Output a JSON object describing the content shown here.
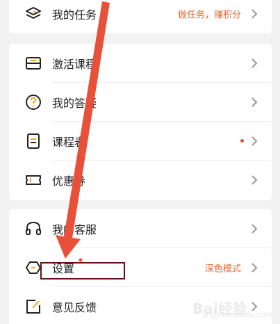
{
  "menu": {
    "group1": [
      {
        "id": "tasks",
        "label": "我的任务",
        "hint": "做任务，赚积分",
        "icon": "stack-layers-icon"
      }
    ],
    "group2": [
      {
        "id": "activate-course",
        "label": "激活课程",
        "icon": "ticket-icon"
      },
      {
        "id": "my-qa",
        "label": "我的答疑",
        "icon": "question-circle-icon"
      },
      {
        "id": "schedule",
        "label": "课程表",
        "icon": "schedule-list-icon",
        "badge": "red-dot"
      },
      {
        "id": "coupon",
        "label": "优惠券",
        "icon": "coupon-icon"
      }
    ],
    "group3": [
      {
        "id": "customer-service",
        "label": "我的客服",
        "icon": "headset-icon"
      },
      {
        "id": "settings",
        "label": "设置",
        "hint": "深色模式",
        "icon": "settings-hexagon-icon"
      },
      {
        "id": "feedback",
        "label": "意见反馈",
        "icon": "edit-feedback-icon"
      }
    ]
  },
  "colors": {
    "accent": "#e26a30",
    "badge": "#e9493a",
    "annotation_arrow": "#e8503a",
    "annotation_box": "#6b0f0f"
  },
  "watermark": {
    "brand": "Bai经验",
    "sub": "jingyan.baidu.com"
  }
}
